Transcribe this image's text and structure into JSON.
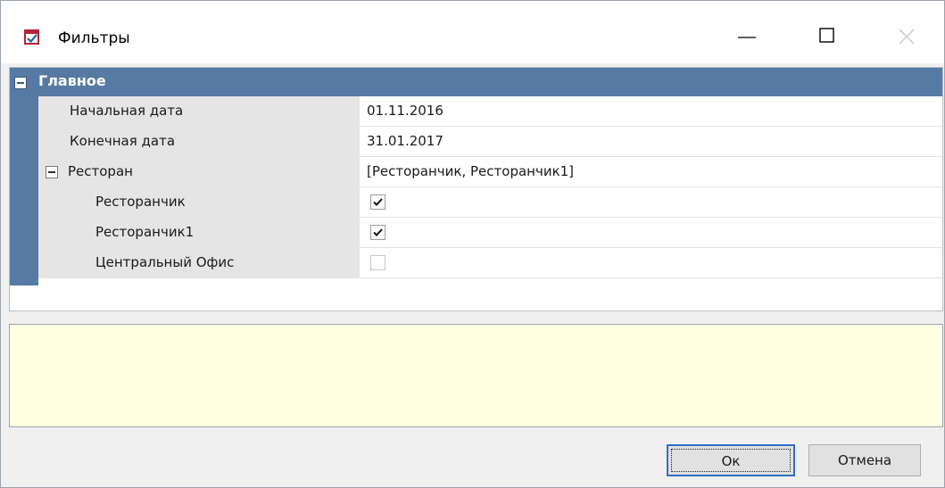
{
  "window": {
    "title": "Фильтры",
    "controls": {
      "minimize": "minimize-icon",
      "maximize": "maximize-icon",
      "close": "close-icon"
    }
  },
  "grid": {
    "category": "Главное",
    "rows": [
      {
        "name": "Начальная дата",
        "value": "01.11.2016"
      },
      {
        "name": "Конечная дата",
        "value": "31.01.2017"
      },
      {
        "name": "Ресторан",
        "value": "[Ресторанчик, Ресторанчик1]"
      }
    ],
    "restaurants": [
      {
        "name": "Ресторанчик",
        "checked": true
      },
      {
        "name": "Ресторанчик1",
        "checked": true
      },
      {
        "name": "Центральный Офис",
        "checked": false
      }
    ]
  },
  "description": {
    "text": ""
  },
  "buttons": {
    "ok": "Ок",
    "cancel": "Отмена"
  },
  "colors": {
    "category_bar": "#567aa3",
    "name_cell": "#e5e5e5",
    "description_bg": "#ffffe1",
    "focus_border": "#2f6fc6"
  }
}
